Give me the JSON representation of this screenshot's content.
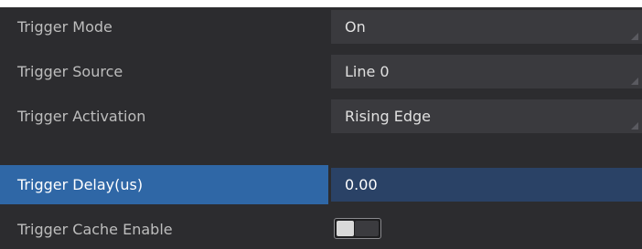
{
  "properties": [
    {
      "label": "Trigger Mode",
      "value": "On",
      "kind": "dropdown",
      "selected": false
    },
    {
      "label": "Trigger Source",
      "value": "Line 0",
      "kind": "dropdown",
      "selected": false
    },
    {
      "label": "Trigger Activation",
      "value": "Rising Edge",
      "kind": "dropdown",
      "selected": false
    },
    {
      "label": "Trigger Delay(us)",
      "value": "0.00",
      "kind": "number",
      "selected": true
    },
    {
      "label": "Trigger Cache Enable",
      "value": "off",
      "kind": "toggle",
      "selected": false
    }
  ],
  "colors": {
    "panel_bg": "#2c2c2f",
    "value_bg": "#3a3a3e",
    "selected_label_bg": "#2f67a6",
    "selected_value_bg": "#2a4266",
    "label_text": "#bdbdbd"
  }
}
